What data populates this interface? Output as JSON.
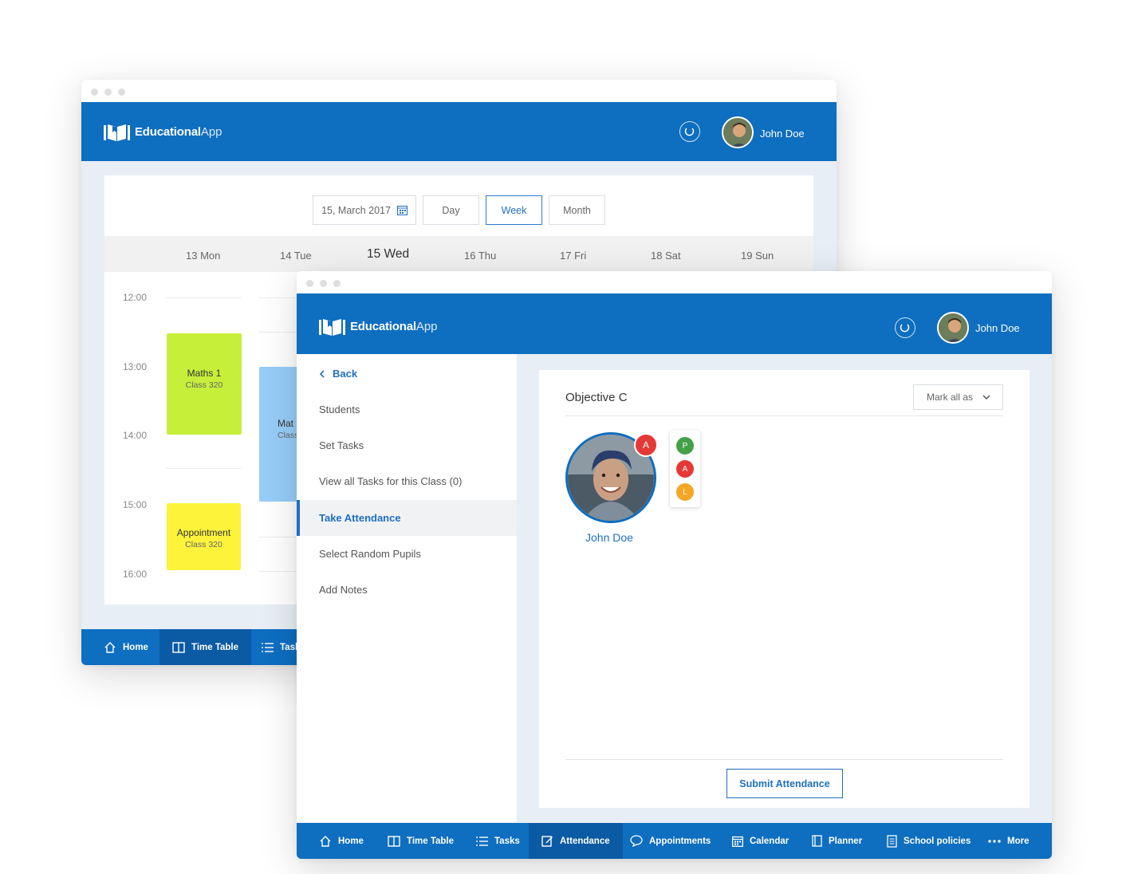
{
  "app": {
    "brand_bold": "Educational",
    "brand_light": "App",
    "user_name": "John Doe"
  },
  "colors": {
    "primary": "#0e6ec0",
    "primary_dark": "#0b5aa4",
    "accent_text": "#1f6fc2",
    "event_green": "#c6ef3a",
    "event_blue": "#97cdf8",
    "event_yellow": "#fef33b",
    "present": "#43a047",
    "absent": "#e53935",
    "late": "#f5a623"
  },
  "calendar": {
    "date_picker": "15, March 2017",
    "views": [
      "Day",
      "Week",
      "Month"
    ],
    "active_view": "Week",
    "days": [
      "13 Mon",
      "14 Tue",
      "15 Wed",
      "16 Thu",
      "17 Fri",
      "18 Sat",
      "19 Sun"
    ],
    "current_day": "15 Wed",
    "times": [
      "12:00",
      "13:00",
      "14:00",
      "15:00",
      "16:00"
    ],
    "events": [
      {
        "title": "Maths 1",
        "sub": "Class 320"
      },
      {
        "title": "Mat",
        "sub": "Class"
      },
      {
        "title": "Appointment",
        "sub": "Class 320"
      }
    ]
  },
  "back_nav": [
    {
      "label": "Home",
      "icon": "home-icon"
    },
    {
      "label": "Time Table",
      "icon": "book-icon"
    },
    {
      "label": "Task",
      "icon": "list-icon"
    }
  ],
  "sidebar": {
    "back_label": "Back",
    "items": [
      "Students",
      "Set Tasks",
      "View all Tasks for this Class (0)",
      "Take Attendance",
      "Select Random Pupils",
      "Add Notes"
    ],
    "active": "Take Attendance"
  },
  "attendance": {
    "objective_title": "Objective C",
    "mark_all_label": "Mark all as",
    "student_name": "John Doe",
    "current_status": "A",
    "options": [
      "P",
      "A",
      "L"
    ],
    "submit_label": "Submit Attendance"
  },
  "front_nav": [
    {
      "label": "Home",
      "icon": "home-icon"
    },
    {
      "label": "Time Table",
      "icon": "book-icon"
    },
    {
      "label": "Tasks",
      "icon": "list-icon"
    },
    {
      "label": "Attendance",
      "icon": "edit-icon"
    },
    {
      "label": "Appointments",
      "icon": "chat-bubble-icon"
    },
    {
      "label": "Calendar",
      "icon": "calendar-icon"
    },
    {
      "label": "Planner",
      "icon": "planner-icon"
    },
    {
      "label": "School policies",
      "icon": "document-icon"
    },
    {
      "label": "More",
      "icon": "more-dots-icon"
    }
  ],
  "front_nav_active": "Attendance"
}
